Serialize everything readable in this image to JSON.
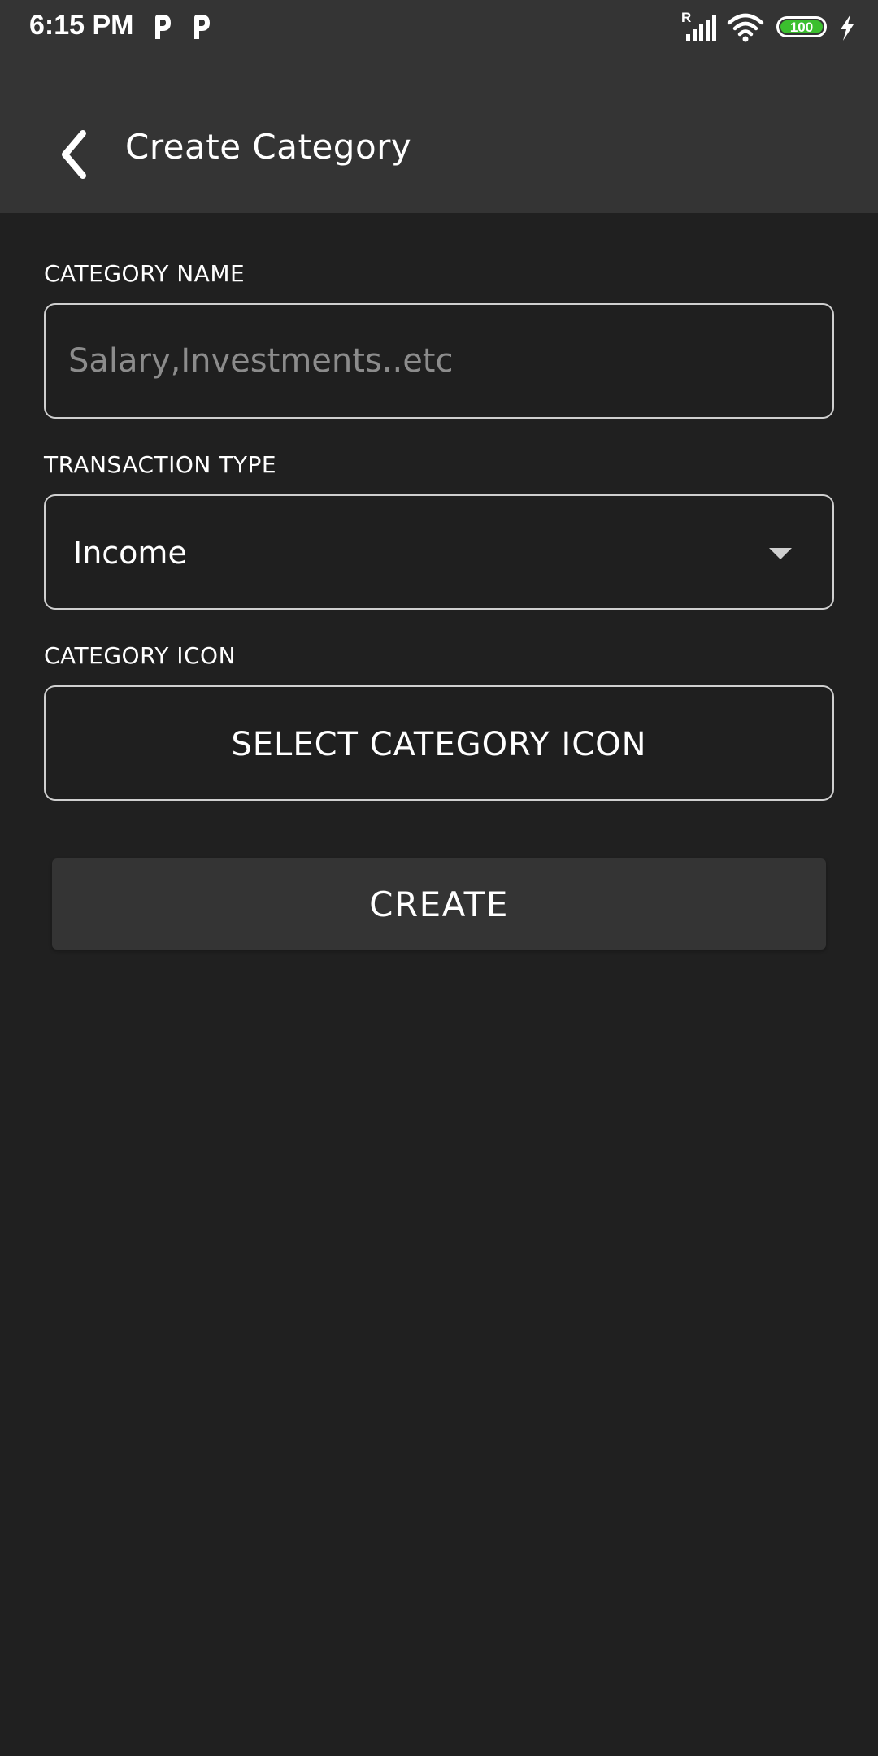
{
  "status_bar": {
    "time": "6:15 PM",
    "notification_icons": [
      "p-icon",
      "p-icon"
    ],
    "signal_indicator": "R",
    "battery_level": "100",
    "icons": [
      "signal-icon",
      "wifi-icon",
      "battery-icon",
      "charging-icon"
    ]
  },
  "app_bar": {
    "title": "Create Category",
    "back_icon": "chevron-left-icon"
  },
  "form": {
    "category_name": {
      "label": "CATEGORY NAME",
      "value": "",
      "placeholder": "Salary,Investments..etc"
    },
    "transaction_type": {
      "label": "TRANSACTION TYPE",
      "selected": "Income",
      "icon": "dropdown-arrow-icon"
    },
    "category_icon": {
      "label": "CATEGORY ICON",
      "button_label": "SELECT CATEGORY ICON"
    },
    "create_label": "CREATE"
  },
  "colors": {
    "background": "#202020",
    "app_bar": "#343434",
    "field_border": "#cfcfcf",
    "placeholder": "#8c8c8c",
    "battery_fill": "#3bbf2e"
  }
}
